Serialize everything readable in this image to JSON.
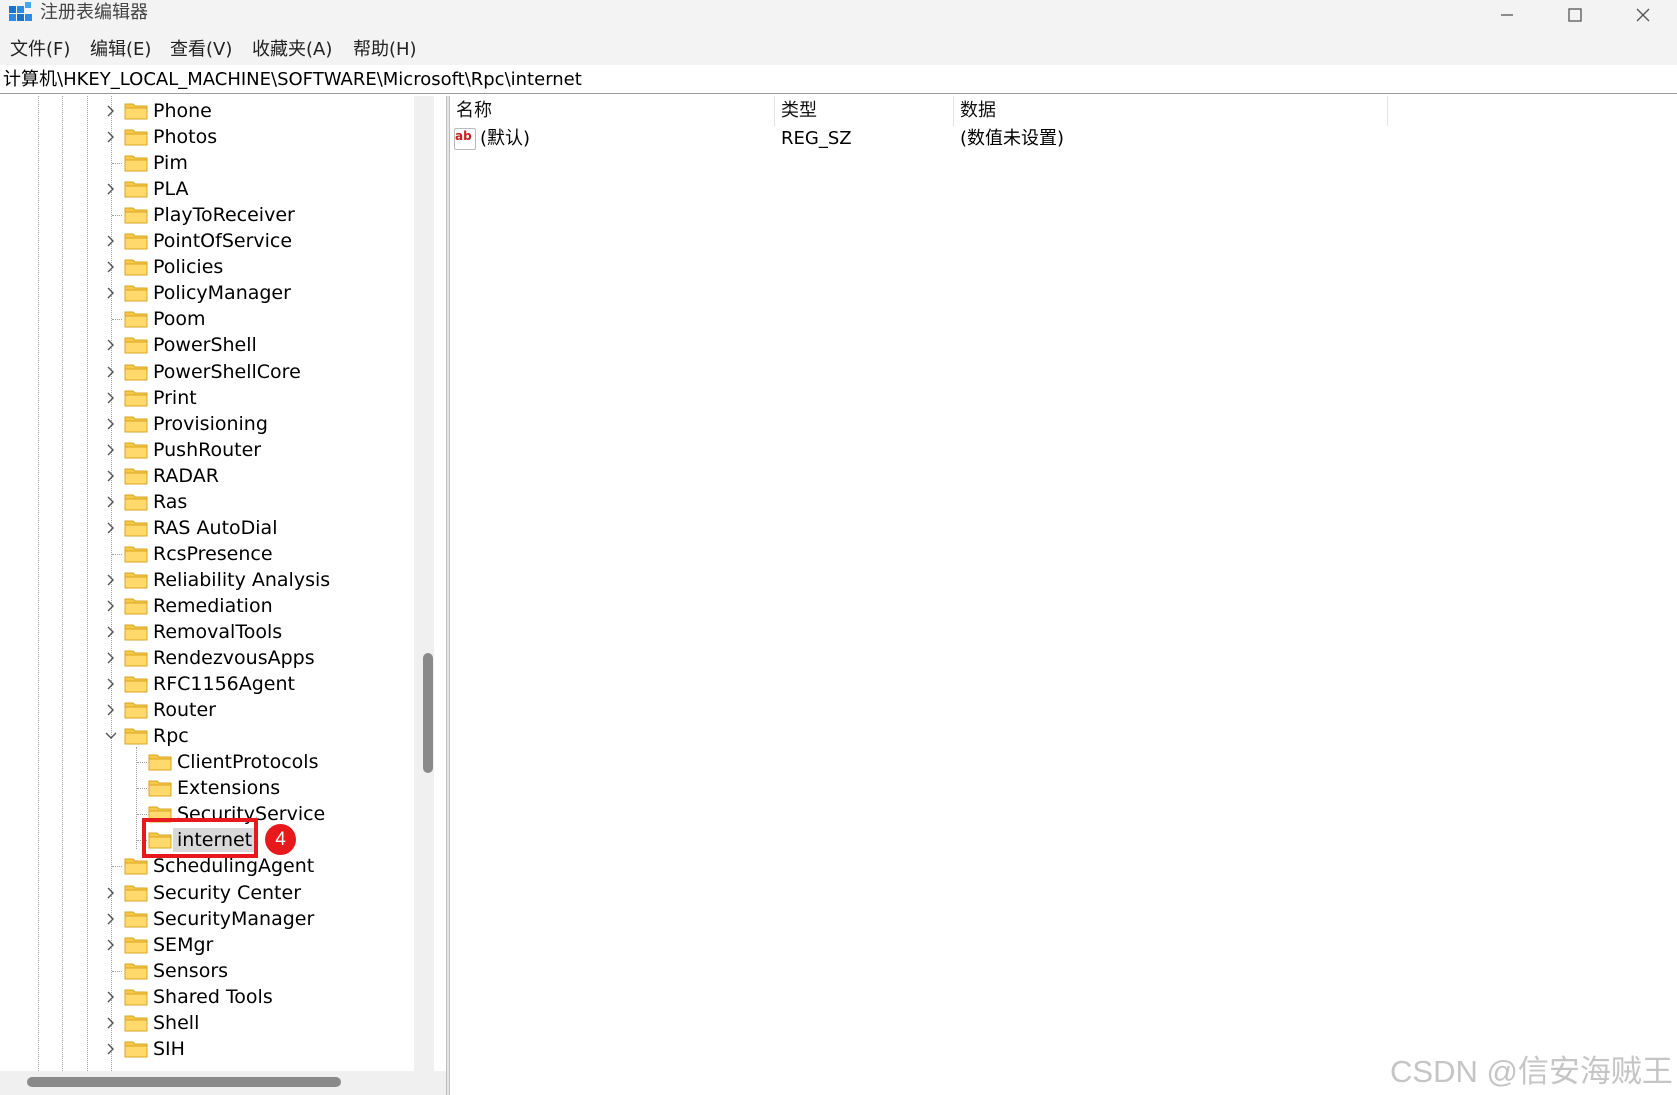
{
  "window": {
    "title": "注册表编辑器"
  },
  "menu": [
    "文件(F)",
    "编辑(E)",
    "查看(V)",
    "收藏夹(A)",
    "帮助(H)"
  ],
  "address": "计算机\\HKEY_LOCAL_MACHINE\\SOFTWARE\\Microsoft\\Rpc\\internet",
  "tree": [
    {
      "label": "Phone",
      "level": 1,
      "expander": "collapsed"
    },
    {
      "label": "Photos",
      "level": 1,
      "expander": "collapsed"
    },
    {
      "label": "Pim",
      "level": 1,
      "expander": "none"
    },
    {
      "label": "PLA",
      "level": 1,
      "expander": "collapsed"
    },
    {
      "label": "PlayToReceiver",
      "level": 1,
      "expander": "none"
    },
    {
      "label": "PointOfService",
      "level": 1,
      "expander": "collapsed"
    },
    {
      "label": "Policies",
      "level": 1,
      "expander": "collapsed"
    },
    {
      "label": "PolicyManager",
      "level": 1,
      "expander": "collapsed"
    },
    {
      "label": "Poom",
      "level": 1,
      "expander": "none"
    },
    {
      "label": "PowerShell",
      "level": 1,
      "expander": "collapsed"
    },
    {
      "label": "PowerShellCore",
      "level": 1,
      "expander": "collapsed"
    },
    {
      "label": "Print",
      "level": 1,
      "expander": "collapsed"
    },
    {
      "label": "Provisioning",
      "level": 1,
      "expander": "collapsed"
    },
    {
      "label": "PushRouter",
      "level": 1,
      "expander": "collapsed"
    },
    {
      "label": "RADAR",
      "level": 1,
      "expander": "collapsed"
    },
    {
      "label": "Ras",
      "level": 1,
      "expander": "collapsed"
    },
    {
      "label": "RAS AutoDial",
      "level": 1,
      "expander": "collapsed"
    },
    {
      "label": "RcsPresence",
      "level": 1,
      "expander": "none"
    },
    {
      "label": "Reliability Analysis",
      "level": 1,
      "expander": "collapsed"
    },
    {
      "label": "Remediation",
      "level": 1,
      "expander": "collapsed"
    },
    {
      "label": "RemovalTools",
      "level": 1,
      "expander": "collapsed"
    },
    {
      "label": "RendezvousApps",
      "level": 1,
      "expander": "collapsed"
    },
    {
      "label": "RFC1156Agent",
      "level": 1,
      "expander": "collapsed"
    },
    {
      "label": "Router",
      "level": 1,
      "expander": "collapsed"
    },
    {
      "label": "Rpc",
      "level": 1,
      "expander": "expanded"
    },
    {
      "label": "ClientProtocols",
      "level": 2,
      "expander": "none"
    },
    {
      "label": "Extensions",
      "level": 2,
      "expander": "none"
    },
    {
      "label": "SecurityService",
      "level": 2,
      "expander": "none"
    },
    {
      "label": "internet",
      "level": 2,
      "expander": "none",
      "selected": true
    },
    {
      "label": "SchedulingAgent",
      "level": 1,
      "expander": "none"
    },
    {
      "label": "Security Center",
      "level": 1,
      "expander": "collapsed"
    },
    {
      "label": "SecurityManager",
      "level": 1,
      "expander": "collapsed"
    },
    {
      "label": "SEMgr",
      "level": 1,
      "expander": "collapsed"
    },
    {
      "label": "Sensors",
      "level": 1,
      "expander": "none"
    },
    {
      "label": "Shared Tools",
      "level": 1,
      "expander": "collapsed"
    },
    {
      "label": "Shell",
      "level": 1,
      "expander": "collapsed"
    },
    {
      "label": "SIH",
      "level": 1,
      "expander": "collapsed"
    }
  ],
  "list": {
    "columns": [
      "名称",
      "类型",
      "数据"
    ],
    "rows": [
      {
        "name": "(默认)",
        "type": "REG_SZ",
        "data": "(数值未设置)",
        "icon": "ab-string-icon",
        "icon_text": "ab"
      }
    ]
  },
  "annotation": {
    "badge": "4",
    "color": "#e8191c"
  },
  "watermark": "CSDN @信安海贼王",
  "colors": {
    "folder": "#f6c94a",
    "selection": "#d9d9d9",
    "chrome": "#f3f3f3"
  }
}
